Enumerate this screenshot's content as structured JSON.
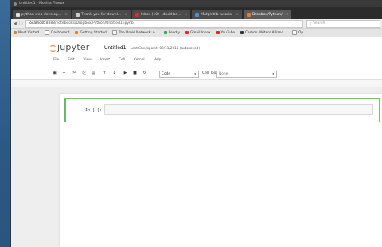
{
  "window": {
    "title": "Untitled1 - Mozilla Firefox"
  },
  "tabs": [
    {
      "label": "python web develop...",
      "color": "#e0e0e0",
      "active": false
    },
    {
      "label": "Thank you for downl...",
      "color": "#cccccc",
      "active": false
    },
    {
      "label": "Inbox (10) - druid ba...",
      "color": "#d93025",
      "active": false
    },
    {
      "label": "Matplotlib tutorial",
      "color": "#4a90d9",
      "active": false
    },
    {
      "label": "Dropbox/Python/",
      "color": "#e67e22",
      "active": true
    }
  ],
  "navbar": {
    "back_icon": "back-arrow-icon",
    "url_host": "localhost",
    "url_path": ":8888/notebooks/Dropbox/Python/Untitled1.ipynb",
    "search_placeholder": "Search"
  },
  "bookmarks": [
    {
      "label": "Most Visited",
      "color": "#e67e22"
    },
    {
      "label": "Dashboard",
      "color": "#ffffff"
    },
    {
      "label": "Getting Started",
      "color": "#e67e22"
    },
    {
      "label": "The Druid Network: A...",
      "color": "#ffffff"
    },
    {
      "label": "Feedly",
      "color": "#2bb24c"
    },
    {
      "label": "Gmail Inbox",
      "color": "#d93025"
    },
    {
      "label": "YouTube",
      "color": "#e62117"
    },
    {
      "label": "Carbon Writers Allianc...",
      "color": "#333333"
    },
    {
      "label": "Op",
      "color": "#ffffff"
    }
  ],
  "jupyter": {
    "logo_text": "jupyter",
    "notebook_name": "Untitled1",
    "checkpoint": "Last Checkpoint: 09/11/2015 (autosaved)",
    "menu": [
      "File",
      "Edit",
      "View",
      "Insert",
      "Cell",
      "Kernel",
      "Help"
    ],
    "toolbar_icons": [
      "save-icon",
      "plus-icon",
      "cut-icon",
      "copy-icon",
      "paste-icon",
      "move-up-icon",
      "move-down-icon",
      "run-icon",
      "stop-icon",
      "restart-icon"
    ],
    "cell_type": "Code",
    "celltoolbar_label": "Cell Toolbar:",
    "celltoolbar_value": "None",
    "cell_prompt": "In [ ]:"
  }
}
